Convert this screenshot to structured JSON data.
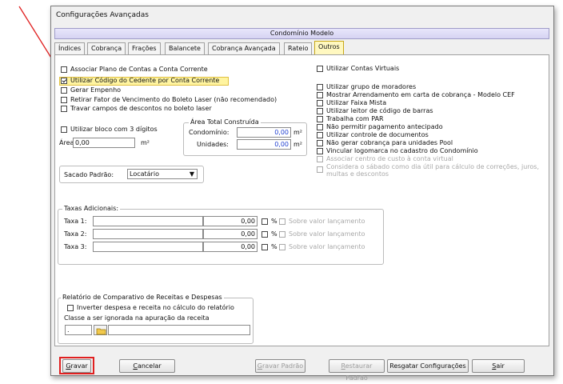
{
  "window": {
    "title": "Configurações Avançadas"
  },
  "condominio": "Condomínio Modelo",
  "tabs": [
    "Índices",
    "Cobrança",
    "Frações",
    "Balancete",
    "Cobrança Avançada",
    "Rateio",
    "Outros"
  ],
  "left_options": {
    "associar": {
      "label": "Associar Plano de Contas a Conta Corrente",
      "checked": false
    },
    "codigo_cedente": {
      "label": "Utilizar Código do Cedente por Conta Corrente",
      "checked": true
    },
    "empenho": {
      "label": "Gerar Empenho",
      "checked": false
    },
    "retirar_fator": {
      "label": "Retirar Fator de Vencimento do Boleto Laser (não recomendado)",
      "checked": false
    },
    "travar_campos": {
      "label": "Travar campos de descontos no boleto laser",
      "checked": false
    },
    "bloco3": {
      "label": "Utilizar bloco com 3 dígitos",
      "checked": false
    }
  },
  "area": {
    "label": "Área:",
    "value": "0,00",
    "unit": "m²"
  },
  "area_total": {
    "title": "Área Total Construída",
    "condominio_label": "Condomínio:",
    "condominio_value": "0,00",
    "unidades_label": "Unidades:",
    "unidades_value": "0,00",
    "unit": "m²"
  },
  "sacado": {
    "label": "Sacado Padrão:",
    "value": "Locatário",
    "arrow": "▼"
  },
  "right_options": [
    {
      "label": "Utilizar Contas Virtuais",
      "checked": false,
      "disabled": false
    },
    {
      "label": "Utilizar grupo de moradores",
      "checked": false,
      "disabled": false
    },
    {
      "label": "Mostrar Arrendamento em carta de cobrança - Modelo CEF",
      "checked": false,
      "disabled": false
    },
    {
      "label": "Utilizar Faixa Mista",
      "checked": false,
      "disabled": false
    },
    {
      "label": "Utilizar leitor de código de barras",
      "checked": false,
      "disabled": false
    },
    {
      "label": "Trabalha com PAR",
      "checked": false,
      "disabled": false
    },
    {
      "label": "Não permitir pagamento antecipado",
      "checked": false,
      "disabled": false
    },
    {
      "label": "Utilizar controle de documentos",
      "checked": false,
      "disabled": false
    },
    {
      "label": "Não gerar cobrança para unidades Pool",
      "checked": false,
      "disabled": false
    },
    {
      "label": "Vincular logomarca no cadastro do Condomínio",
      "checked": false,
      "disabled": false
    },
    {
      "label": "Associar centro de custo à conta virtual",
      "checked": false,
      "disabled": true
    },
    {
      "label": "Considera o sábado como dia útil para cálculo de correções, juros,",
      "label2": "multas e descontos",
      "checked": false,
      "disabled": true
    }
  ],
  "taxas": {
    "title": "Taxas Adicionais:",
    "rows": [
      {
        "label": "Taxa 1:",
        "value": "0,00",
        "pct": "%",
        "sobre": "Sobre valor lançamento"
      },
      {
        "label": "Taxa 2:",
        "value": "0,00",
        "pct": "%",
        "sobre": "Sobre valor lançamento"
      },
      {
        "label": "Taxa 3:",
        "value": "0,00",
        "pct": "%",
        "sobre": "Sobre valor lançamento"
      }
    ]
  },
  "relatorio": {
    "title": "Relatório de Comparativo de Receitas e Despesas",
    "inverter": "Inverter despesa e receita no cálculo do relatório",
    "classe": "Classe a ser ignorada na apuração da receita",
    "classe_value": "."
  },
  "buttons": {
    "gravar": "Gravar",
    "cancelar": "Cancelar",
    "gravar_padrao": "Gravar Padrão",
    "restaurar": "Restaurar Padrão",
    "resgatar": "Resgatar Configurações",
    "sair": "Sair"
  },
  "colors": {
    "annotation": "#e02020",
    "highlight": "#fff4a0",
    "active_tab": "#fff8c0",
    "value_blue": "#1f3fd0"
  }
}
